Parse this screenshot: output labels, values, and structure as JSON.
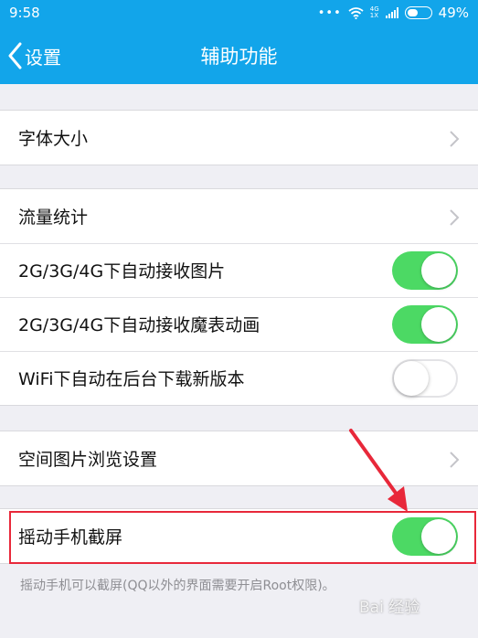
{
  "status_bar": {
    "time": "9:58",
    "dots": "•••",
    "network_tag_top": "4G",
    "network_tag_bottom": "1X",
    "battery_percent": "49%",
    "battery_level": 0.49,
    "icons": [
      "wifi-icon",
      "signal-icon",
      "battery-icon"
    ]
  },
  "nav": {
    "back_label": "设置",
    "title": "辅助功能"
  },
  "groups": [
    {
      "rows": [
        {
          "label": "字体大小",
          "control": "chevron"
        }
      ]
    },
    {
      "rows": [
        {
          "label": "流量统计",
          "control": "chevron"
        },
        {
          "label": "2G/3G/4G下自动接收图片",
          "control": "toggle",
          "on": true
        },
        {
          "label": "2G/3G/4G下自动接收魔表动画",
          "control": "toggle",
          "on": true
        },
        {
          "label": "WiFi下自动在后台下载新版本",
          "control": "toggle",
          "on": false
        }
      ]
    },
    {
      "rows": [
        {
          "label": "空间图片浏览设置",
          "control": "chevron"
        }
      ]
    },
    {
      "rows": [
        {
          "label": "摇动手机截屏",
          "control": "toggle",
          "on": true
        }
      ]
    }
  ],
  "caption": "摇动手机可以截屏(QQ以外的界面需要开启Root权限)。",
  "watermark": "Bai 经验",
  "colors": {
    "accent": "#12a5ea",
    "toggle_on": "#4cd964",
    "annotation_red": "#e8283a",
    "background": "#efeff4"
  }
}
